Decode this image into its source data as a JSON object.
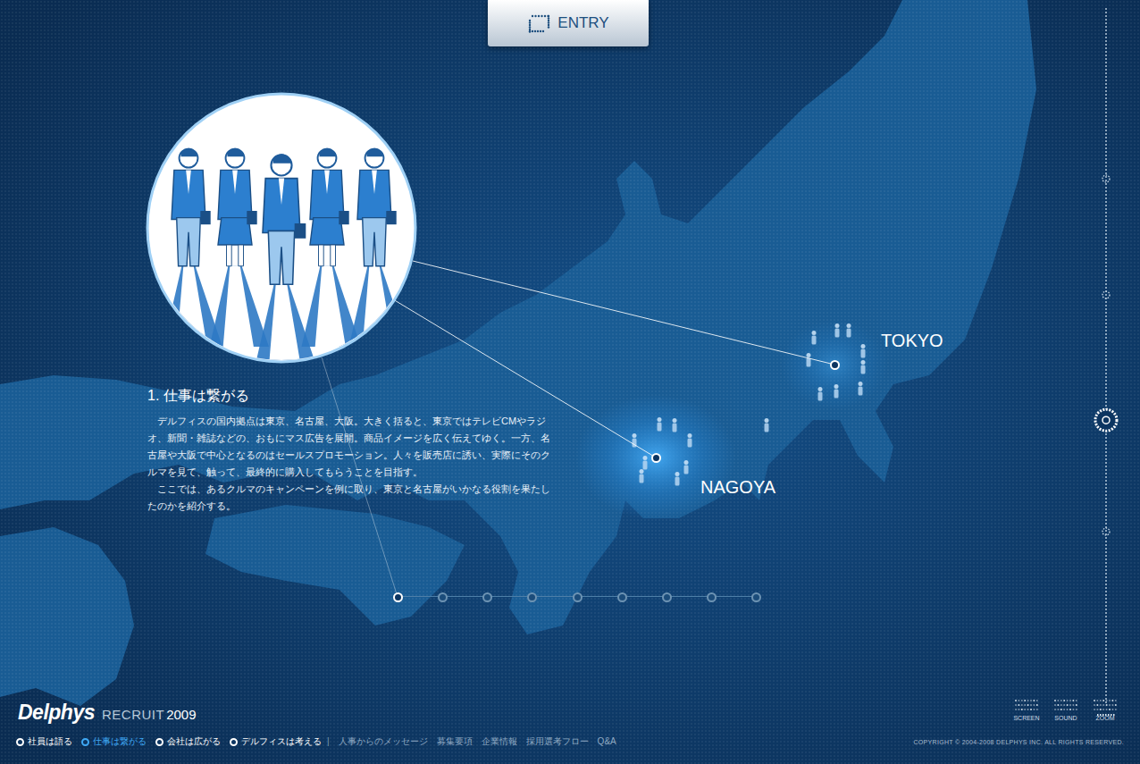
{
  "entry_button": {
    "label": "ENTRY"
  },
  "article": {
    "title": "1. 仕事は繋がる",
    "paragraphs": [
      "　デルフィスの国内拠点は東京、名古屋、大阪。大きく括ると、東京ではテレビCMやラジオ、新聞・雑誌などの、おもにマス広告を展開。商品イメージを広く伝えてゆく。一方、名古屋や大阪で中心となるのはセールスプロモーション。人々を販売店に誘い、実際にそのクルマを見て、触って、最終的に購入してもらうことを目指す。",
      "　ここでは、あるクルマのキャンペーンを例に取り、東京と名古屋がいかなる役割を果たしたのかを紹介する。"
    ]
  },
  "map": {
    "cities": [
      {
        "name": "TOKYO"
      },
      {
        "name": "NAGOYA"
      }
    ]
  },
  "timeline": {
    "steps": [
      {
        "selected": true
      },
      {
        "selected": false
      },
      {
        "selected": false
      },
      {
        "selected": false
      },
      {
        "selected": false
      },
      {
        "selected": false
      },
      {
        "selected": false
      },
      {
        "selected": false
      },
      {
        "selected": false
      }
    ]
  },
  "zoom_slider": {
    "level": 0.41
  },
  "controls": [
    {
      "label": "SCREEN"
    },
    {
      "label": "SOUND"
    },
    {
      "label": "ZOOM"
    }
  ],
  "logo": {
    "brand": "Delphys",
    "product": "RECRUIT",
    "year": "2009"
  },
  "nav": {
    "chapters": [
      {
        "label": "社員は語る",
        "selected": false
      },
      {
        "label": "仕事は繋がる",
        "selected": true
      },
      {
        "label": "会社は広がる",
        "selected": false
      },
      {
        "label": "デルフィスは考える",
        "selected": false
      }
    ],
    "separator": "|",
    "links": [
      {
        "label": "人事からのメッセージ"
      },
      {
        "label": "募集要項"
      },
      {
        "label": "企業情報"
      },
      {
        "label": "採用選考フロー"
      },
      {
        "label": "Q&A"
      }
    ]
  },
  "copyright": "COPYRIGHT © 2004-2008 DELPHYS INC. ALL RIGHTS RESERVED."
}
